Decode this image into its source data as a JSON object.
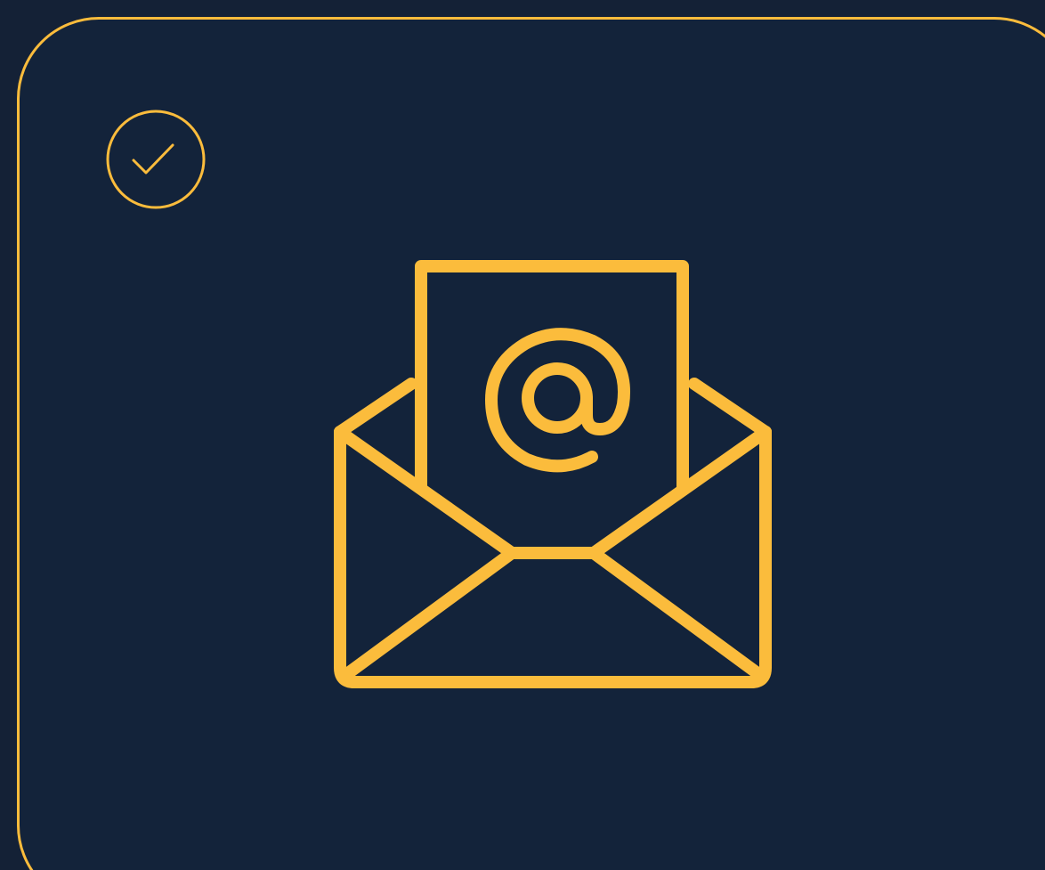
{
  "card": {
    "selected": true,
    "icon": "email-open-icon",
    "badge_icon": "check-circle-icon"
  },
  "colors": {
    "background": "#142136",
    "card_background": "#13233A",
    "accent": "#FBBC3C"
  }
}
